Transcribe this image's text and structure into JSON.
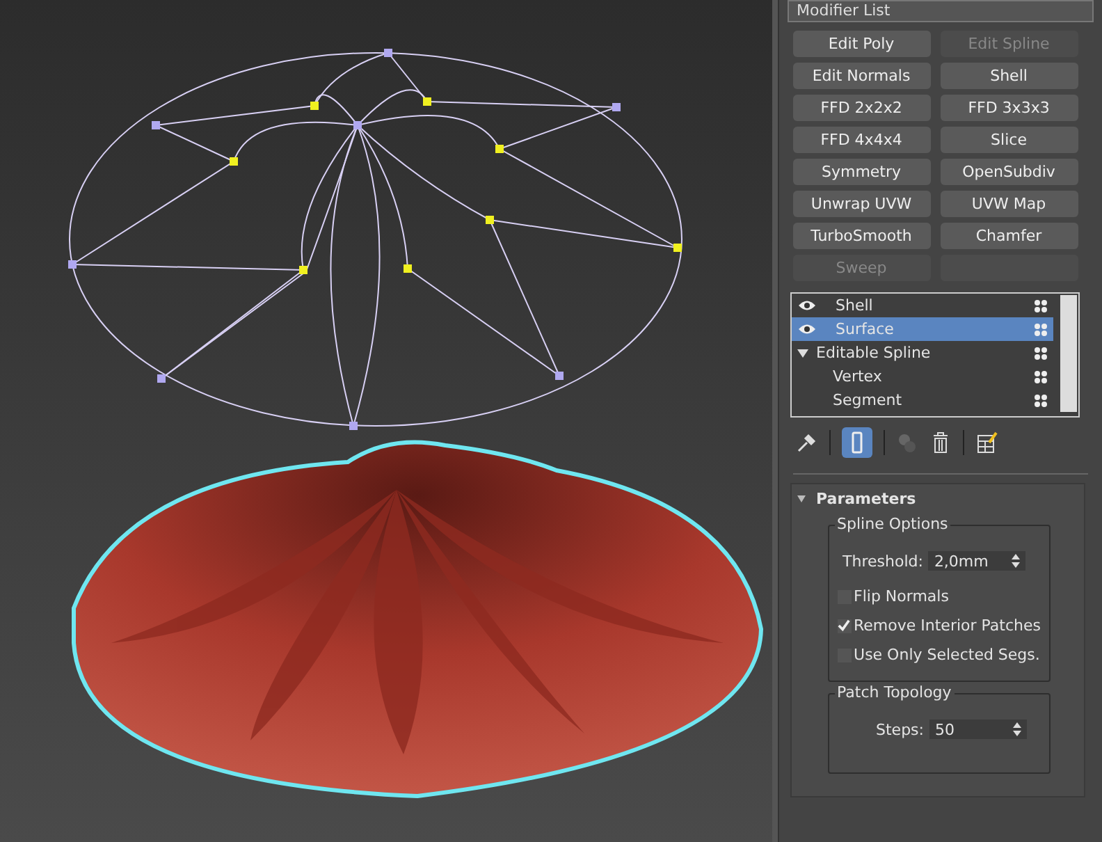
{
  "modifier_list": {
    "label": "Modifier List"
  },
  "buttons": [
    {
      "label": "Edit Poly",
      "disabled": false
    },
    {
      "label": "Edit Spline",
      "disabled": true
    },
    {
      "label": "Edit Normals",
      "disabled": false
    },
    {
      "label": "Shell",
      "disabled": false
    },
    {
      "label": "FFD 2x2x2",
      "disabled": false
    },
    {
      "label": "FFD 3x3x3",
      "disabled": false
    },
    {
      "label": "FFD 4x4x4",
      "disabled": false
    },
    {
      "label": "Slice",
      "disabled": false
    },
    {
      "label": "Symmetry",
      "disabled": false
    },
    {
      "label": "OpenSubdiv",
      "disabled": false
    },
    {
      "label": "Unwrap UVW",
      "disabled": false
    },
    {
      "label": "UVW Map",
      "disabled": false
    },
    {
      "label": "TurboSmooth",
      "disabled": false
    },
    {
      "label": "Chamfer",
      "disabled": false
    },
    {
      "label": "Sweep",
      "disabled": true
    }
  ],
  "stack": [
    {
      "label": "Shell",
      "kind": "modifier",
      "selected": false
    },
    {
      "label": "Surface",
      "kind": "modifier",
      "selected": true
    },
    {
      "label": "Editable Spline",
      "kind": "object",
      "selected": false,
      "expanded": true,
      "children": [
        {
          "label": "Vertex",
          "selected": false
        },
        {
          "label": "Segment",
          "selected": false
        }
      ]
    }
  ],
  "stack_toolbar": {
    "show_end_result_on": true
  },
  "parameters": {
    "title": "Parameters",
    "expanded": true,
    "spline_options": {
      "title": "Spline Options",
      "threshold_label": "Threshold:",
      "threshold_value": "2,0mm",
      "checkboxes": [
        {
          "label": "Flip Normals",
          "checked": false
        },
        {
          "label": "Remove Interior Patches",
          "checked": true
        },
        {
          "label": "Use Only Selected Segs.",
          "checked": false
        }
      ]
    },
    "patch_topology": {
      "title": "Patch Topology",
      "steps_label": "Steps:",
      "steps_value": "50"
    }
  }
}
